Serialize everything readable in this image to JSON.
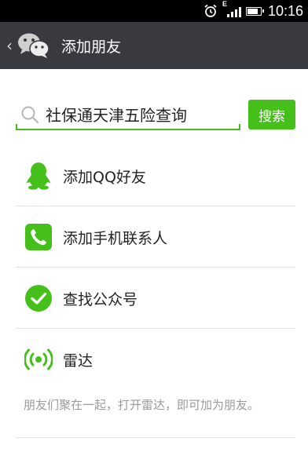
{
  "status_bar": {
    "time": "10:16",
    "network_type": "E",
    "battery_level": 0.85,
    "icons": [
      "alarm-icon",
      "signal-icon",
      "battery-icon"
    ]
  },
  "title_bar": {
    "back_icon": "back-arrow-icon",
    "logo_icon": "wechat-logo-icon",
    "title": "添加朋友"
  },
  "search": {
    "value": "社保通天津五险查询",
    "icon": "search-icon",
    "button_label": "搜索"
  },
  "menu": {
    "items": [
      {
        "icon": "qq-penguin-icon",
        "label": "添加QQ好友"
      },
      {
        "icon": "phone-icon",
        "label": "添加手机联系人"
      },
      {
        "icon": "check-circle-icon",
        "label": "查找公众号"
      },
      {
        "icon": "radar-icon",
        "label": "雷达"
      }
    ]
  },
  "hint": "朋友们聚在一起，打开雷达，即可加为朋友。",
  "colors": {
    "accent": "#45c01a",
    "title_bar": "#393a3f",
    "status_bar": "#000000",
    "divider": "#e2e2e2",
    "hint_text": "#9a9a9a"
  }
}
